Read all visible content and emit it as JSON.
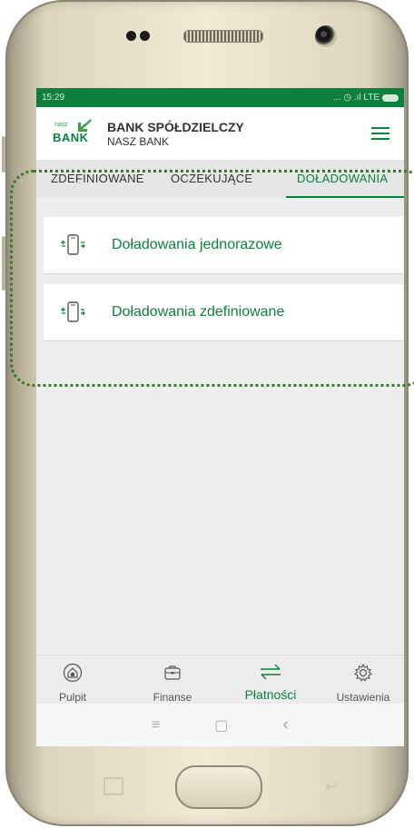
{
  "status_bar": {
    "time": "15:29",
    "indicators": "... ◷ .ıl LTE",
    "battery_icon": "battery-icon"
  },
  "header": {
    "logo_top": "nasz",
    "logo_bottom": "BANK",
    "title": "BANK SPÓŁDZIELCZY",
    "subtitle": "NASZ BANK",
    "menu_icon": "hamburger-menu-icon"
  },
  "tabs": [
    {
      "label": "ZDEFINIOWANE",
      "active": false
    },
    {
      "label": "OCZEKUJĄCE",
      "active": false
    },
    {
      "label": "DOŁADOWANIA",
      "active": true
    }
  ],
  "items": [
    {
      "label": "Doładowania jednorazowe",
      "icon": "phone-topup-icon"
    },
    {
      "label": "Doładowania zdefiniowane",
      "icon": "phone-topup-icon"
    }
  ],
  "bottom_nav": [
    {
      "label": "Pulpit",
      "icon": "home-icon",
      "active": false
    },
    {
      "label": "Finanse",
      "icon": "wallet-icon",
      "active": false
    },
    {
      "label": "Płatności",
      "icon": "transfer-arrows-icon",
      "active": true
    },
    {
      "label": "Ustawienia",
      "icon": "gear-icon",
      "active": false
    }
  ],
  "system_nav": {
    "menu": "≡",
    "home": "▢",
    "back": "‹"
  },
  "colors": {
    "brand_green": "#0d7f3f",
    "annotation": "#3b7a2e"
  }
}
